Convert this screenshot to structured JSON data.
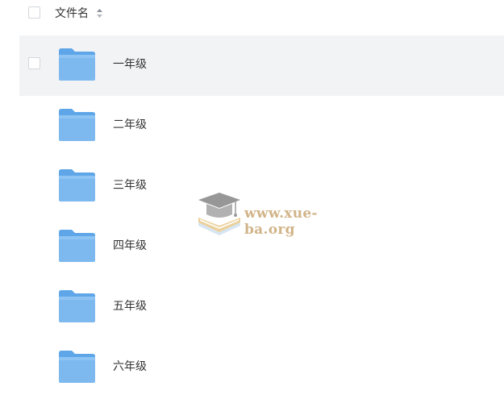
{
  "header": {
    "column_label": "文件名",
    "sort_icon": "sort-updown-icon"
  },
  "files": [
    {
      "name": "一年级",
      "icon": "folder-icon"
    },
    {
      "name": "二年级",
      "icon": "folder-icon"
    },
    {
      "name": "三年级",
      "icon": "folder-icon"
    },
    {
      "name": "四年级",
      "icon": "folder-icon"
    },
    {
      "name": "五年级",
      "icon": "folder-icon"
    },
    {
      "name": "六年级",
      "icon": "folder-icon"
    }
  ],
  "watermark": {
    "text": "www.xue-ba.org",
    "icon": "graduation-cap-icon"
  },
  "colors": {
    "folder_body": "#7db9ef",
    "folder_tab": "#5ea6e8",
    "hover_row": "#f2f3f5",
    "watermark_text": "#c9a774"
  }
}
